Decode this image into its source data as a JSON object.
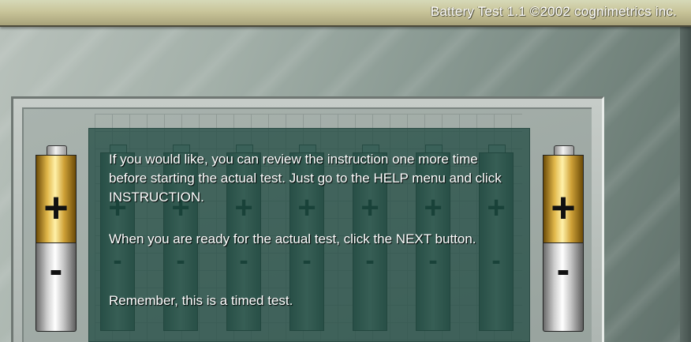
{
  "window": {
    "title": "Battery  Test 1.1 ©2002  cognimetrics inc."
  },
  "battery_glyphs": {
    "plus": "+",
    "minus": "-"
  },
  "instructions": {
    "paragraph_1": "If you would like, you can review the instruction one more time before starting the actual test.  Just go to the HELP menu and click INSTRUCTION.",
    "paragraph_2": "When you are ready for the actual test, click the NEXT button.",
    "paragraph_3": "Remember, this is a timed test."
  },
  "colors": {
    "panel": "#18443c",
    "battery_gold": "#e1b74a",
    "battery_silver": "#cfcfcf"
  }
}
